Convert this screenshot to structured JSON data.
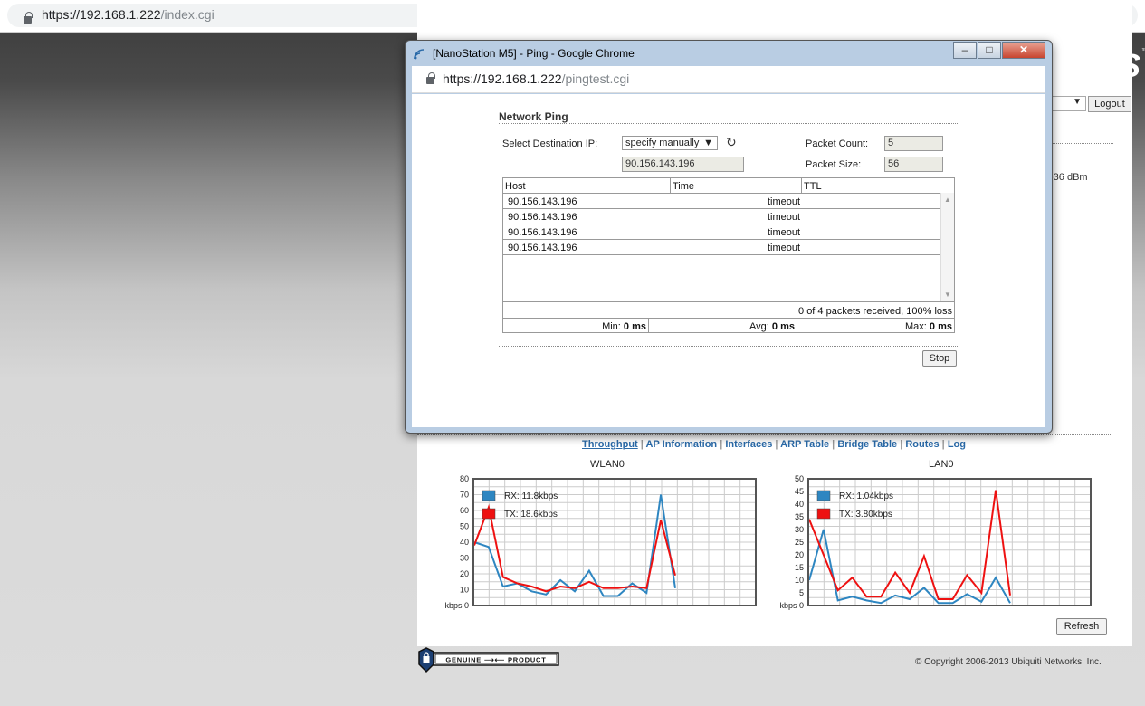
{
  "browser": {
    "url_host": "https://192.168.1.222",
    "url_path": "/index.cgi"
  },
  "main": {
    "logo": "airOS",
    "logout_label": "Logout",
    "signal": "-36 dBm",
    "tabs": [
      {
        "label": "Throughput",
        "active": true
      },
      {
        "label": "AP Information"
      },
      {
        "label": "Interfaces"
      },
      {
        "label": "ARP Table"
      },
      {
        "label": "Bridge Table"
      },
      {
        "label": "Routes"
      },
      {
        "label": "Log"
      }
    ],
    "refresh_label": "Refresh",
    "genuine": "GENUINE PRODUCT",
    "copyright": "© Copyright 2006-2013 Ubiquiti Networks, Inc."
  },
  "popup": {
    "title": "[NanoStation M5] - Ping - Google Chrome",
    "url_host": "https://192.168.1.222",
    "url_path": "/pingtest.cgi",
    "section_title": "Network Ping",
    "dest_label": "Select Destination IP:",
    "dest_select": "specify manually",
    "dest_ip": "90.156.143.196",
    "packet_count_label": "Packet Count:",
    "packet_count": "5",
    "packet_size_label": "Packet Size:",
    "packet_size": "56",
    "columns": [
      "Host",
      "Time",
      "TTL"
    ],
    "rows": [
      {
        "host": "90.156.143.196",
        "time": "timeout",
        "ttl": ""
      },
      {
        "host": "90.156.143.196",
        "time": "timeout",
        "ttl": ""
      },
      {
        "host": "90.156.143.196",
        "time": "timeout",
        "ttl": ""
      },
      {
        "host": "90.156.143.196",
        "time": "timeout",
        "ttl": ""
      }
    ],
    "summary": "0 of 4 packets received, 100% loss",
    "min_label": "Min:",
    "min_value": "0 ms",
    "avg_label": "Avg:",
    "avg_value": "0 ms",
    "max_label": "Max:",
    "max_value": "0 ms",
    "stop_label": "Stop"
  },
  "chart_data": [
    {
      "type": "line",
      "title": "WLAN0",
      "ylabel": "kbps",
      "ylim": [
        0,
        80
      ],
      "yticks": [
        0,
        10,
        20,
        30,
        40,
        50,
        60,
        70,
        80
      ],
      "legend": "top-left",
      "grid": true,
      "series": [
        {
          "name": "RX: 11.8kbps",
          "color": "#2e86c1",
          "values": [
            40,
            37,
            12,
            14,
            9,
            7,
            16,
            9,
            22,
            6,
            6,
            14,
            8,
            70,
            11
          ]
        },
        {
          "name": "TX: 18.6kbps",
          "color": "#ee1111",
          "values": [
            38,
            62,
            18,
            14,
            12,
            9,
            12,
            11,
            15,
            11,
            11,
            12,
            11,
            54,
            19
          ]
        }
      ]
    },
    {
      "type": "line",
      "title": "LAN0",
      "ylabel": "kbps",
      "ylim": [
        0,
        50
      ],
      "yticks": [
        0,
        5,
        10,
        15,
        20,
        25,
        30,
        35,
        40,
        45,
        50
      ],
      "legend": "top-left",
      "grid": true,
      "series": [
        {
          "name": "RX: 1.04kbps",
          "color": "#2e86c1",
          "values": [
            10,
            30,
            2,
            3.5,
            2,
            1,
            4,
            2.5,
            7,
            1,
            1,
            4.5,
            1.5,
            11,
            1
          ]
        },
        {
          "name": "TX: 3.80kbps",
          "color": "#ee1111",
          "values": [
            34,
            20,
            6,
            11,
            3.5,
            3.5,
            13,
            5,
            19.5,
            2.5,
            2.5,
            12,
            5,
            45.5,
            4
          ]
        }
      ]
    }
  ],
  "colors": {
    "link": "#2a6aa8",
    "rx": "#2e86c1",
    "tx": "#ee1111"
  }
}
